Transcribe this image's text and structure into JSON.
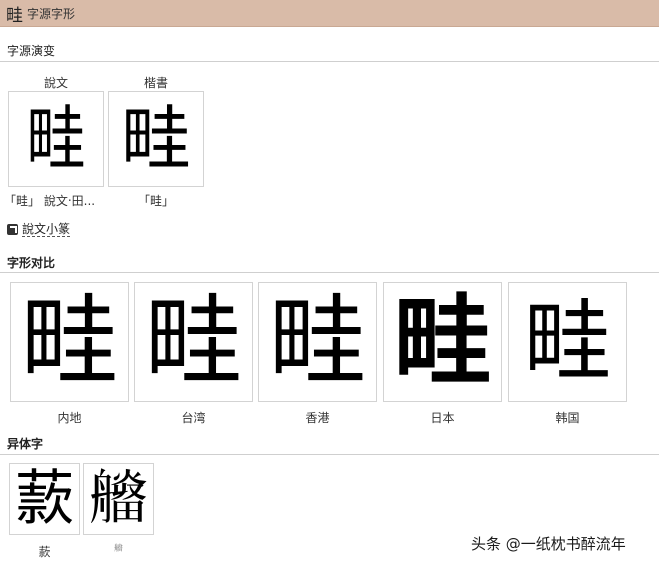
{
  "header": {
    "char": "畦",
    "title": "字源字形"
  },
  "sections": {
    "evolution": "字源演变",
    "compare": "字形对比",
    "variants": "异体字"
  },
  "evolution": {
    "items": [
      {
        "label": "說文",
        "glyph": "畦",
        "caption": "「畦」 說文‧田..."
      },
      {
        "label": "楷書",
        "glyph": "畦",
        "caption": "「畦」"
      }
    ],
    "link": "說文小篆"
  },
  "compare": {
    "items": [
      {
        "glyph": "畦",
        "caption": "内地"
      },
      {
        "glyph": "畦",
        "caption": "台湾"
      },
      {
        "glyph": "畦",
        "caption": "香港"
      },
      {
        "glyph": "畦",
        "caption": "日本"
      },
      {
        "glyph": "畦",
        "caption": "韩国"
      }
    ]
  },
  "variants": {
    "items": [
      {
        "glyph": "䕀",
        "caption": "䕀"
      },
      {
        "glyph": "𤳮",
        "caption": "𤳮"
      }
    ]
  },
  "watermark": "头条 @一纸枕书醉流年"
}
